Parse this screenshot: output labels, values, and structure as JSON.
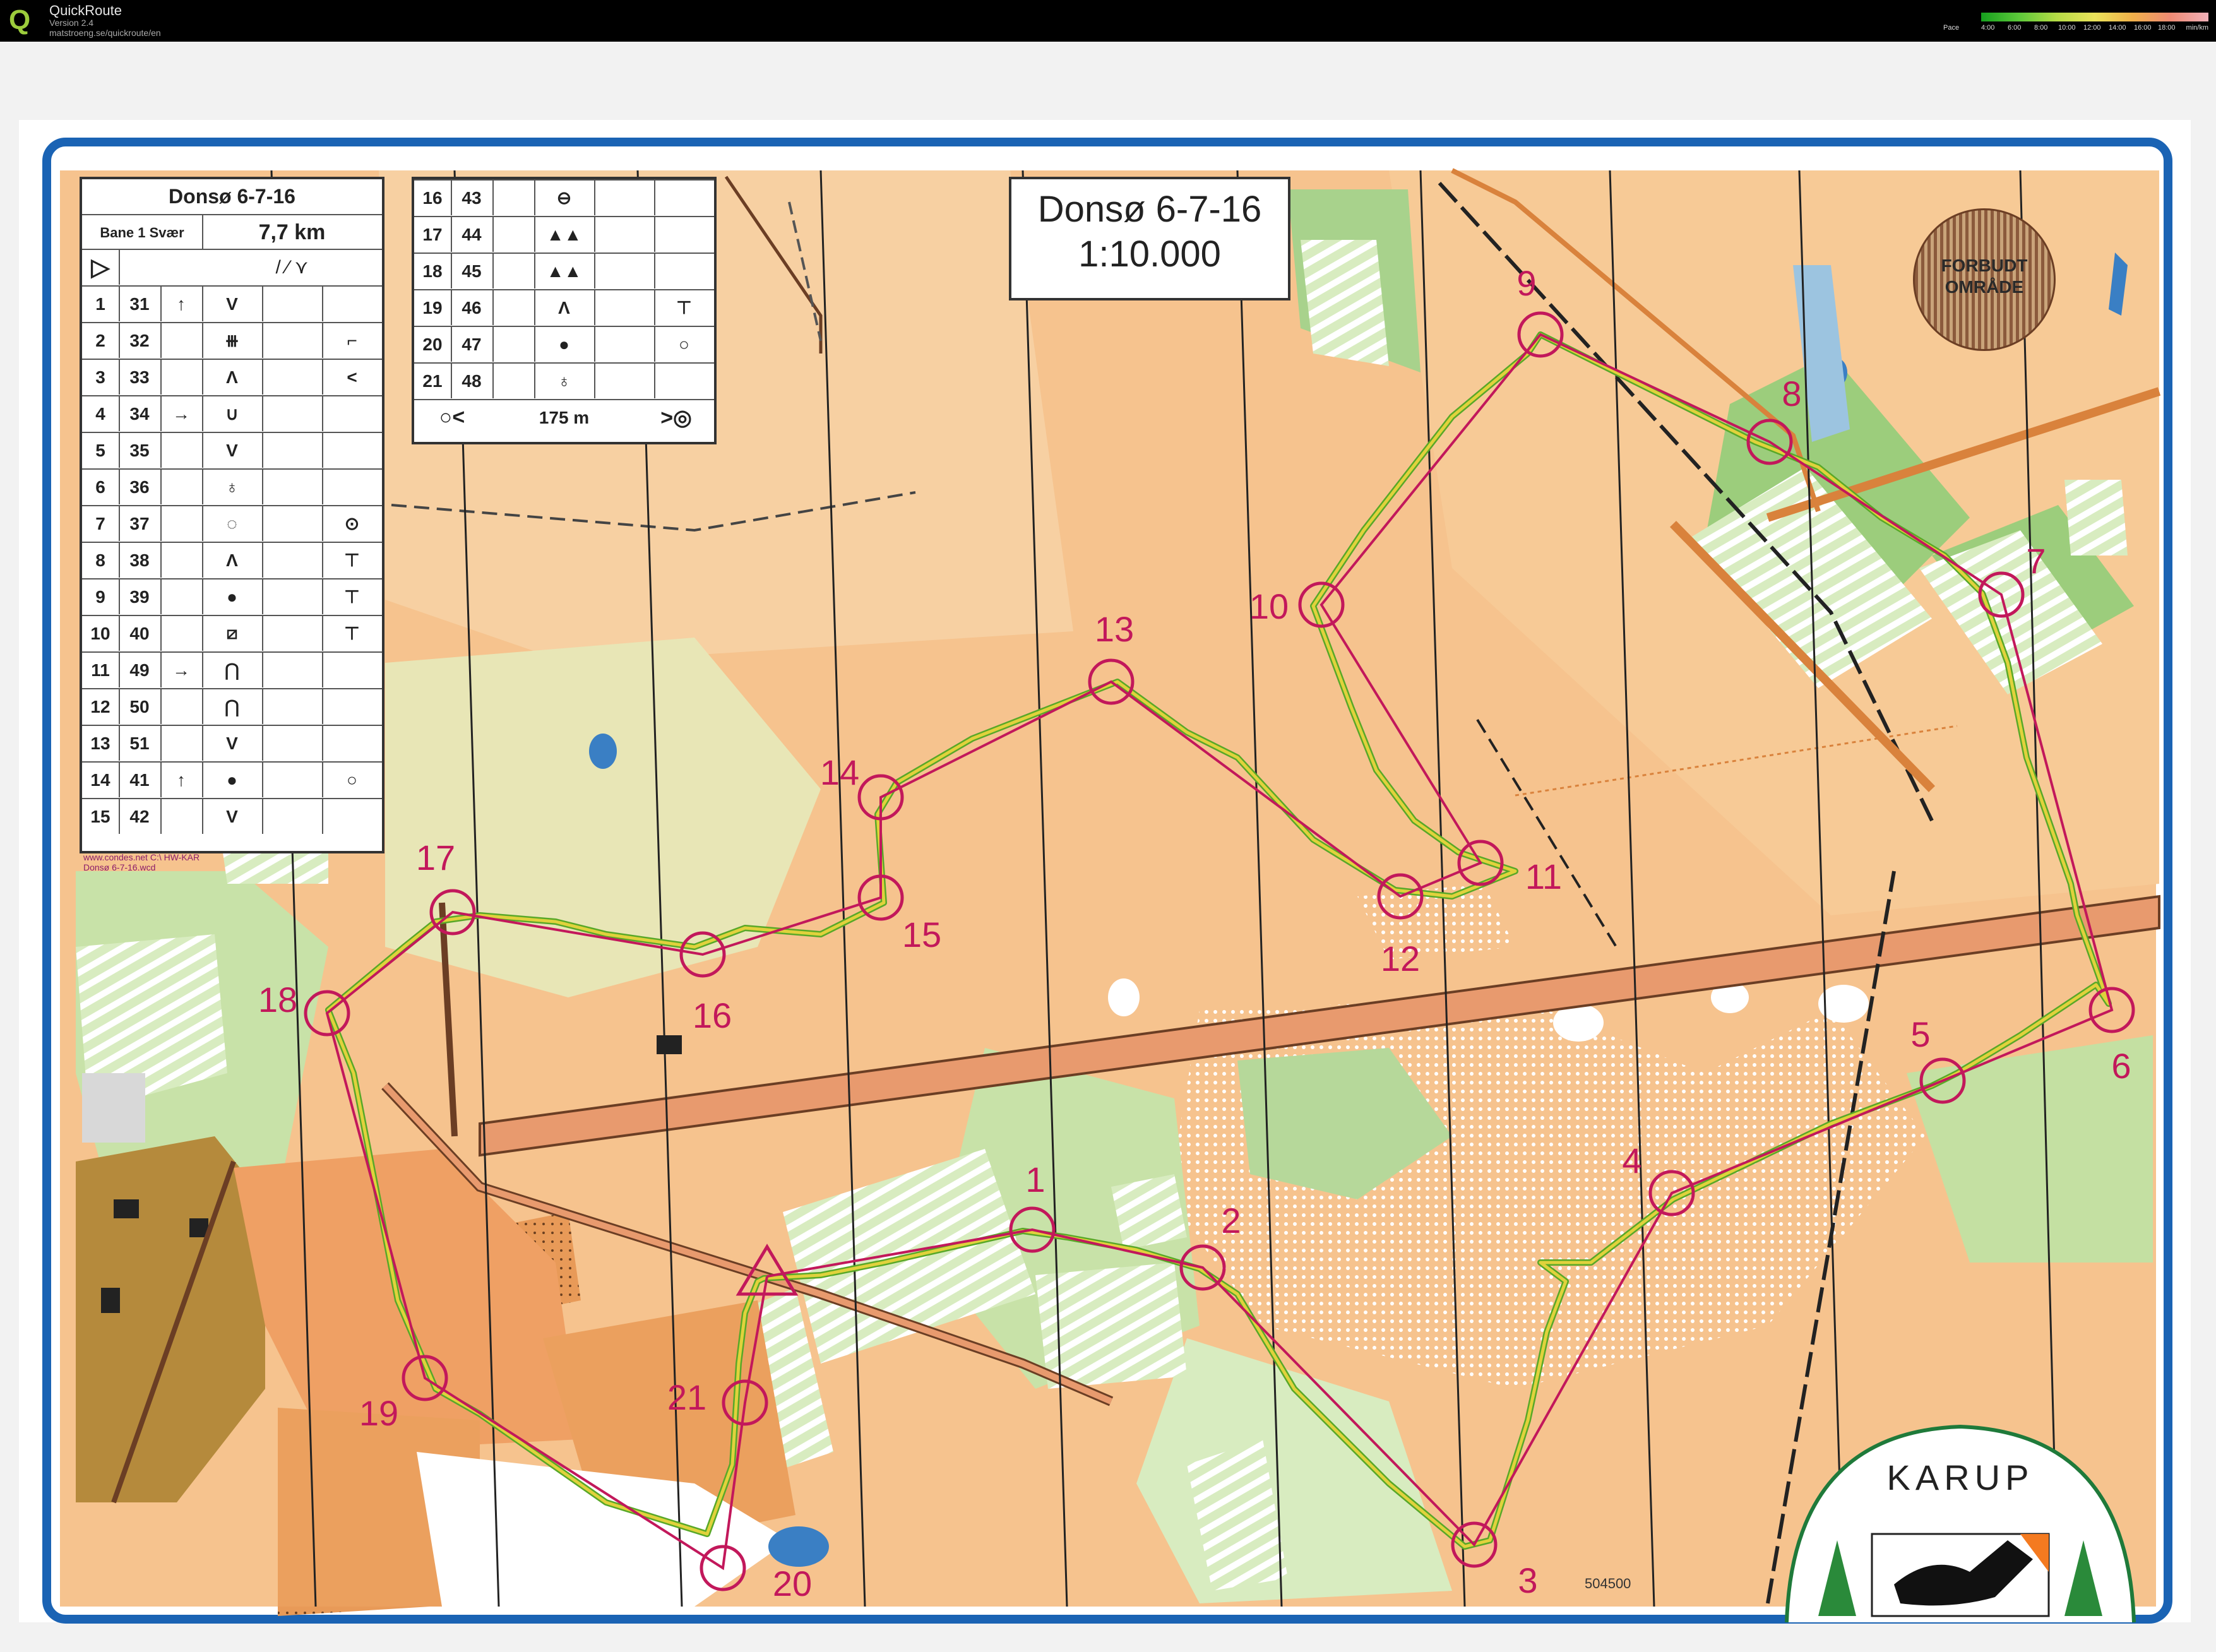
{
  "app": {
    "title": "QuickRoute",
    "version": "Version 2.4",
    "url": "matstroeng.se/quickroute/en",
    "logo": "Q"
  },
  "pace_legend": {
    "label": "Pace",
    "ticks": [
      "4:00",
      "6:00",
      "8:00",
      "10:00",
      "12:00",
      "14:00",
      "16:00",
      "18:00"
    ],
    "unit": "min/km"
  },
  "map": {
    "title_line1": "Donsø 6-7-16",
    "title_line2": "1:10.000",
    "forbidden_line1": "FORBUDT",
    "forbidden_line2": "OMRÅDE",
    "credit_line1": "www.condes.net C:\\ HW-KAR",
    "credit_line2": "Donsø 6-7-16.wcd",
    "map_number": "504500",
    "club_logo_text": "KARUP",
    "controls": [
      "1",
      "2",
      "3",
      "4",
      "5",
      "6",
      "7",
      "8",
      "9",
      "10",
      "11",
      "12",
      "13",
      "14",
      "15",
      "16",
      "17",
      "18",
      "19",
      "20",
      "21"
    ]
  },
  "description_sheet": {
    "event_title": "Donsø 6-7-16",
    "course_name": "Bane 1 Svær",
    "course_length": "7,7 km",
    "start_symbol": "▷",
    "rows": [
      {
        "num": "1",
        "code": "31",
        "dir": "↑",
        "feature": "V",
        "extra": ""
      },
      {
        "num": "2",
        "code": "32",
        "dir": "",
        "feature": "⧻",
        "extra": "⌐"
      },
      {
        "num": "3",
        "code": "33",
        "dir": "",
        "feature": "Λ",
        "extra": "<"
      },
      {
        "num": "4",
        "code": "34",
        "dir": "→",
        "feature": "∪",
        "extra": ""
      },
      {
        "num": "5",
        "code": "35",
        "dir": "",
        "feature": "V",
        "extra": ""
      },
      {
        "num": "6",
        "code": "36",
        "dir": "",
        "feature": "♁",
        "extra": ""
      },
      {
        "num": "7",
        "code": "37",
        "dir": "",
        "feature": "◌",
        "extra": "⊙"
      },
      {
        "num": "8",
        "code": "38",
        "dir": "",
        "feature": "Λ",
        "extra": "⊤"
      },
      {
        "num": "9",
        "code": "39",
        "dir": "",
        "feature": "●",
        "extra": "⊤"
      },
      {
        "num": "10",
        "code": "40",
        "dir": "",
        "feature": "⧄",
        "extra": "⊤"
      },
      {
        "num": "11",
        "code": "49",
        "dir": "→",
        "feature": "⋂",
        "extra": ""
      },
      {
        "num": "12",
        "code": "50",
        "dir": "",
        "feature": "⋂",
        "extra": ""
      },
      {
        "num": "13",
        "code": "51",
        "dir": "",
        "feature": "V",
        "extra": ""
      },
      {
        "num": "14",
        "code": "41",
        "dir": "↑",
        "feature": "●",
        "extra": "○"
      },
      {
        "num": "15",
        "code": "42",
        "dir": "",
        "feature": "V",
        "extra": ""
      }
    ],
    "rows2": [
      {
        "num": "16",
        "code": "43",
        "dir": "",
        "feature": "⊖",
        "extra": ""
      },
      {
        "num": "17",
        "code": "44",
        "dir": "",
        "feature": "▲▲",
        "extra": ""
      },
      {
        "num": "18",
        "code": "45",
        "dir": "",
        "feature": "▲▲",
        "extra": ""
      },
      {
        "num": "19",
        "code": "46",
        "dir": "",
        "feature": "Λ",
        "extra": "⊤"
      },
      {
        "num": "20",
        "code": "47",
        "dir": "",
        "feature": "●",
        "extra": "○"
      },
      {
        "num": "21",
        "code": "48",
        "dir": "",
        "feature": "♁",
        "extra": ""
      }
    ],
    "finish_distance": "175 m",
    "finish_left": "○<",
    "finish_right": ">◎"
  },
  "colors": {
    "map_open": "#f6c38e",
    "map_light": "#f7d5ad",
    "forest_green": "#a8d28c",
    "light_green": "#d8ecc0",
    "control_magenta": "#c2185b",
    "track_yellow": "#e0d23c",
    "track_green": "#58a828",
    "border_blue": "#1a63b4"
  }
}
